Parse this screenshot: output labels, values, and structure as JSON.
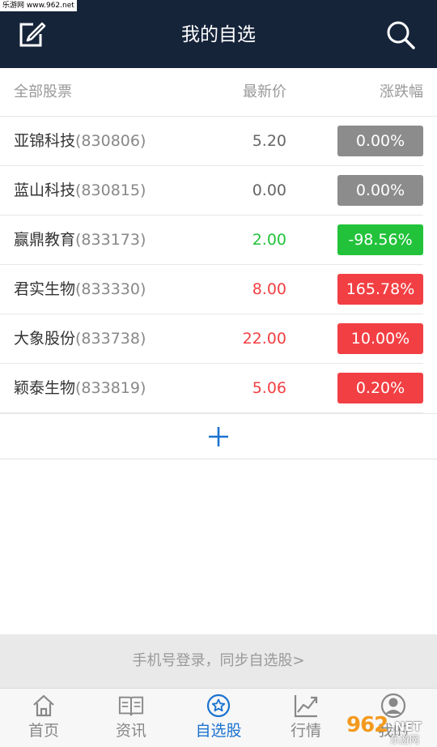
{
  "watermark": {
    "top_text": "乐游网 www.962.net",
    "logo_num": "962",
    "logo_net": ".NET",
    "logo_sub": "乐游网"
  },
  "header": {
    "title": "我的自选",
    "edit_icon": "edit-icon",
    "search_icon": "search-icon"
  },
  "columns": {
    "name": "全部股票",
    "price": "最新价",
    "change": "涨跌幅"
  },
  "colors": {
    "header_bg": "#16243a",
    "up": "#f23f43",
    "down": "#22c33b",
    "flat": "#8c8c8c",
    "accent": "#1b73d0"
  },
  "stocks": [
    {
      "name": "亚锦科技",
      "code": "(830806)",
      "price": "5.20",
      "change": "0.00%",
      "trend": "flat"
    },
    {
      "name": "蓝山科技",
      "code": "(830815)",
      "price": "0.00",
      "change": "0.00%",
      "trend": "flat"
    },
    {
      "name": "赢鼎教育",
      "code": "(833173)",
      "price": "2.00",
      "change": "-98.56%",
      "trend": "down"
    },
    {
      "name": "君实生物",
      "code": "(833330)",
      "price": "8.00",
      "change": "165.78%",
      "trend": "up"
    },
    {
      "name": "大象股份",
      "code": "(833738)",
      "price": "22.00",
      "change": "10.00%",
      "trend": "up"
    },
    {
      "name": "颖泰生物",
      "code": "(833819)",
      "price": "5.06",
      "change": "0.20%",
      "trend": "up"
    }
  ],
  "add_button": {
    "icon": "plus-icon"
  },
  "login_bar": {
    "text": "手机号登录，同步自选股>"
  },
  "tabs": [
    {
      "label": "首页",
      "icon": "home-icon",
      "active": false
    },
    {
      "label": "资讯",
      "icon": "book-icon",
      "active": false
    },
    {
      "label": "自选股",
      "icon": "star-icon",
      "active": true
    },
    {
      "label": "行情",
      "icon": "chart-icon",
      "active": false
    },
    {
      "label": "我的",
      "icon": "user-icon",
      "active": false
    }
  ]
}
